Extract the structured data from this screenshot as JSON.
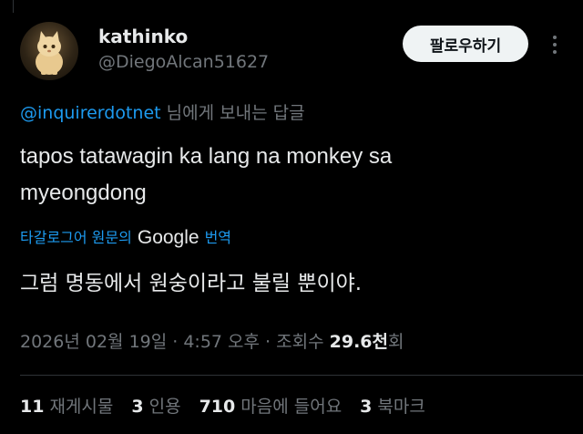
{
  "author": {
    "display_name": "kathinko",
    "handle": "@DiegoAlcan51627",
    "follow_label": "팔로우하기"
  },
  "reply": {
    "mention": "@inquirerdotnet",
    "suffix": " 님에게 보내는 답글"
  },
  "tweet": {
    "line1": "tapos tatawagin ka lang na monkey sa",
    "line2": "myeongdong"
  },
  "translation": {
    "prefix": "타갈로그어 원문의",
    "brand": "Google",
    "suffix": "번역",
    "text": "그럼 명동에서 원숭이라고 불릴 뿐이야."
  },
  "meta": {
    "timestamp": "2026년 02월 19일 · 4:57 오후 · 조회수 ",
    "views_bold": "29.6천",
    "views_suffix": "회"
  },
  "stats": {
    "reposts_count": "11",
    "reposts_label": "재게시물",
    "quotes_count": "3",
    "quotes_label": "인용",
    "likes_count": "710",
    "likes_label": "마음에 들어요",
    "bookmarks_count": "3",
    "bookmarks_label": "북마크"
  },
  "colors": {
    "background": "#000000",
    "text_primary": "#e7e9ea",
    "text_secondary": "#71767b",
    "link_blue": "#1d9bf0",
    "button_bg": "#eff3f4"
  },
  "icons": {
    "more": "more-vertical-icon",
    "avatar": "cat-avatar"
  }
}
